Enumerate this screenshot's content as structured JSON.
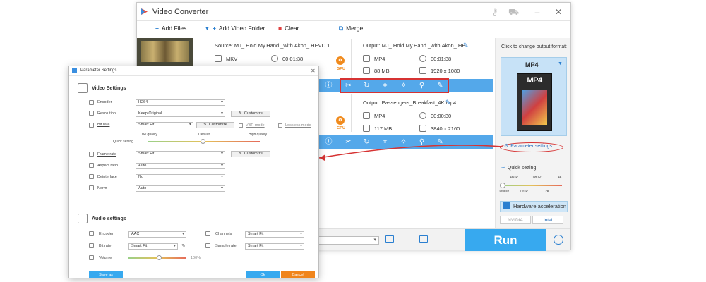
{
  "window": {
    "title": "Video Converter",
    "toolbar": {
      "add_files": "Add Files",
      "add_folder": "Add Video Folder",
      "clear": "Clear",
      "merge": "Merge"
    }
  },
  "items": [
    {
      "source": "Source: MJ_.Hold.My.Hand._with.Akon_.HEVC.1...",
      "src_format": "MKV",
      "src_duration": "00:01:38",
      "output": "Output: MJ_.Hold.My.Hand._with.Akon_.HE...",
      "out_format": "MP4",
      "out_duration": "00:01:38",
      "out_size": "88 MB",
      "out_resolution": "1920 x 1080"
    },
    {
      "output": "Output: Passengers_Breakfast_4K.mp4",
      "out_format": "MP4",
      "out_duration": "00:00:30",
      "out_size": "117 MB",
      "out_resolution": "3840 x 2160"
    }
  ],
  "gpu_label": "GPU",
  "right_panel": {
    "click_hint": "Click to change output format:",
    "format": "MP4",
    "format_card": "MP4",
    "param_settings": "Parameter settings",
    "quick_setting": "Quick setting",
    "quality_top": [
      "480P",
      "1080P",
      "4K"
    ],
    "quality_bottom": [
      "Default",
      "720P",
      "2K"
    ],
    "hw_accel": "Hardware acceleration",
    "chip_nvidia": "NVIDIA",
    "chip_intel": "Intel"
  },
  "run_label": "Run",
  "dialog": {
    "title": "Parameter Settings",
    "video_section": "Video Settings",
    "encoder_label": "Encoder",
    "encoder_value": "H264",
    "resolution_label": "Resolution",
    "resolution_value": "Keep Original",
    "customize": "Customize",
    "bitrate_label": "Bit rate",
    "bitrate_value": "Smart Fit",
    "vbr_mode": "VBR mode",
    "lossless_mode": "Lossless mode",
    "low_quality": "Low quality",
    "default_q": "Default",
    "high_quality": "High quality",
    "quick_setting": "Quick setting",
    "framerate_label": "Frame rate",
    "framerate_value": "Smart Fit",
    "aspect_label": "Aspect ratio",
    "aspect_value": "Auto",
    "deinterlace_label": "Deinterlace",
    "deinterlace_value": "No",
    "norm_label": "Norm",
    "norm_value": "Auto",
    "audio_section": "Audio settings",
    "a_encoder_label": "Encoder",
    "a_encoder_value": "AAC",
    "channels_label": "Channels",
    "channels_value": "Smart Fit",
    "a_bitrate_label": "Bit rate",
    "a_bitrate_value": "Smart Fit",
    "samplerate_label": "Sample rate",
    "samplerate_value": "Smart Fit",
    "volume_label": "Volume",
    "volume_value": "100%",
    "save_as": "Save as",
    "ok": "Ok",
    "cancel": "Cancel"
  },
  "colors": {
    "accent_blue": "#37a9ef",
    "highlight_red": "#d63333",
    "gpu_orange": "#f08a1c",
    "cancel_orange": "#f0851c"
  }
}
